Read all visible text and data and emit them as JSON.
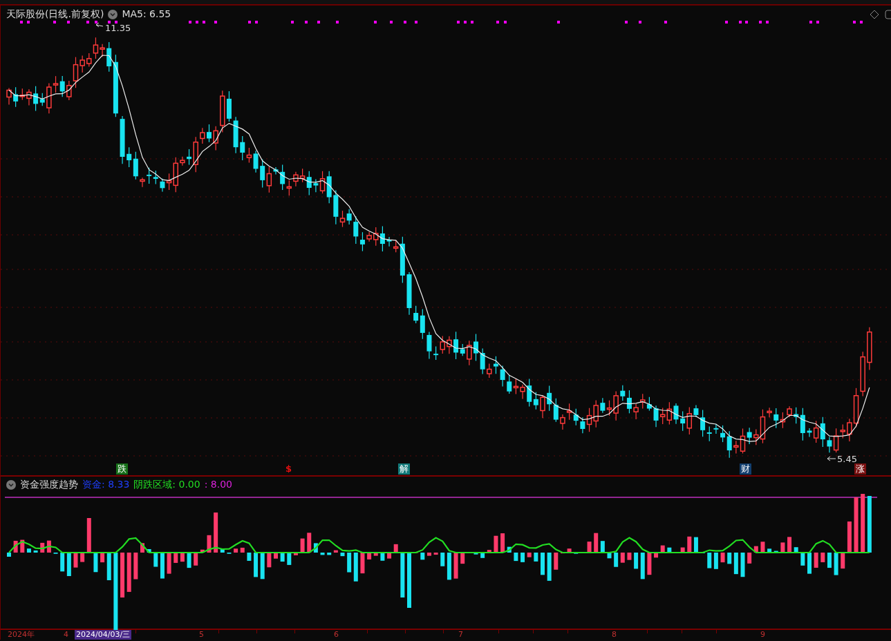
{
  "chart": {
    "title": "天际股份(日线.前复权)",
    "ma_label": "MA5: 6.55",
    "high_label": "11.35",
    "low_label": "5.45"
  },
  "event_markers": [
    {
      "text": "跌",
      "kind": "tag",
      "color": "#17701a"
    },
    {
      "text": "$",
      "kind": "glyph",
      "color": "#e01010"
    },
    {
      "text": "解",
      "kind": "tag",
      "color": "#127a7a"
    },
    {
      "text": "财",
      "kind": "tag",
      "color": "#123e6e"
    },
    {
      "text": "涨",
      "kind": "tag",
      "color": "#7a1010"
    }
  ],
  "indicator": {
    "title": "资金强度趋势",
    "legend": [
      {
        "text": "资金: 8.33",
        "color": "#1f3fff"
      },
      {
        "text": "阴跌区域: 0.00",
        "color": "#22dd22"
      },
      {
        "text": ": 8.00",
        "color": "#dd22dd"
      }
    ]
  },
  "time_axis": [
    {
      "label": "2024年",
      "selected": false
    },
    {
      "label": "4",
      "selected": false
    },
    {
      "label": "2024/04/03/三",
      "selected": true
    },
    {
      "label": "5",
      "selected": false
    },
    {
      "label": "6",
      "selected": false
    },
    {
      "label": "7",
      "selected": false
    },
    {
      "label": "8",
      "selected": false
    },
    {
      "label": "9",
      "selected": false
    }
  ]
}
